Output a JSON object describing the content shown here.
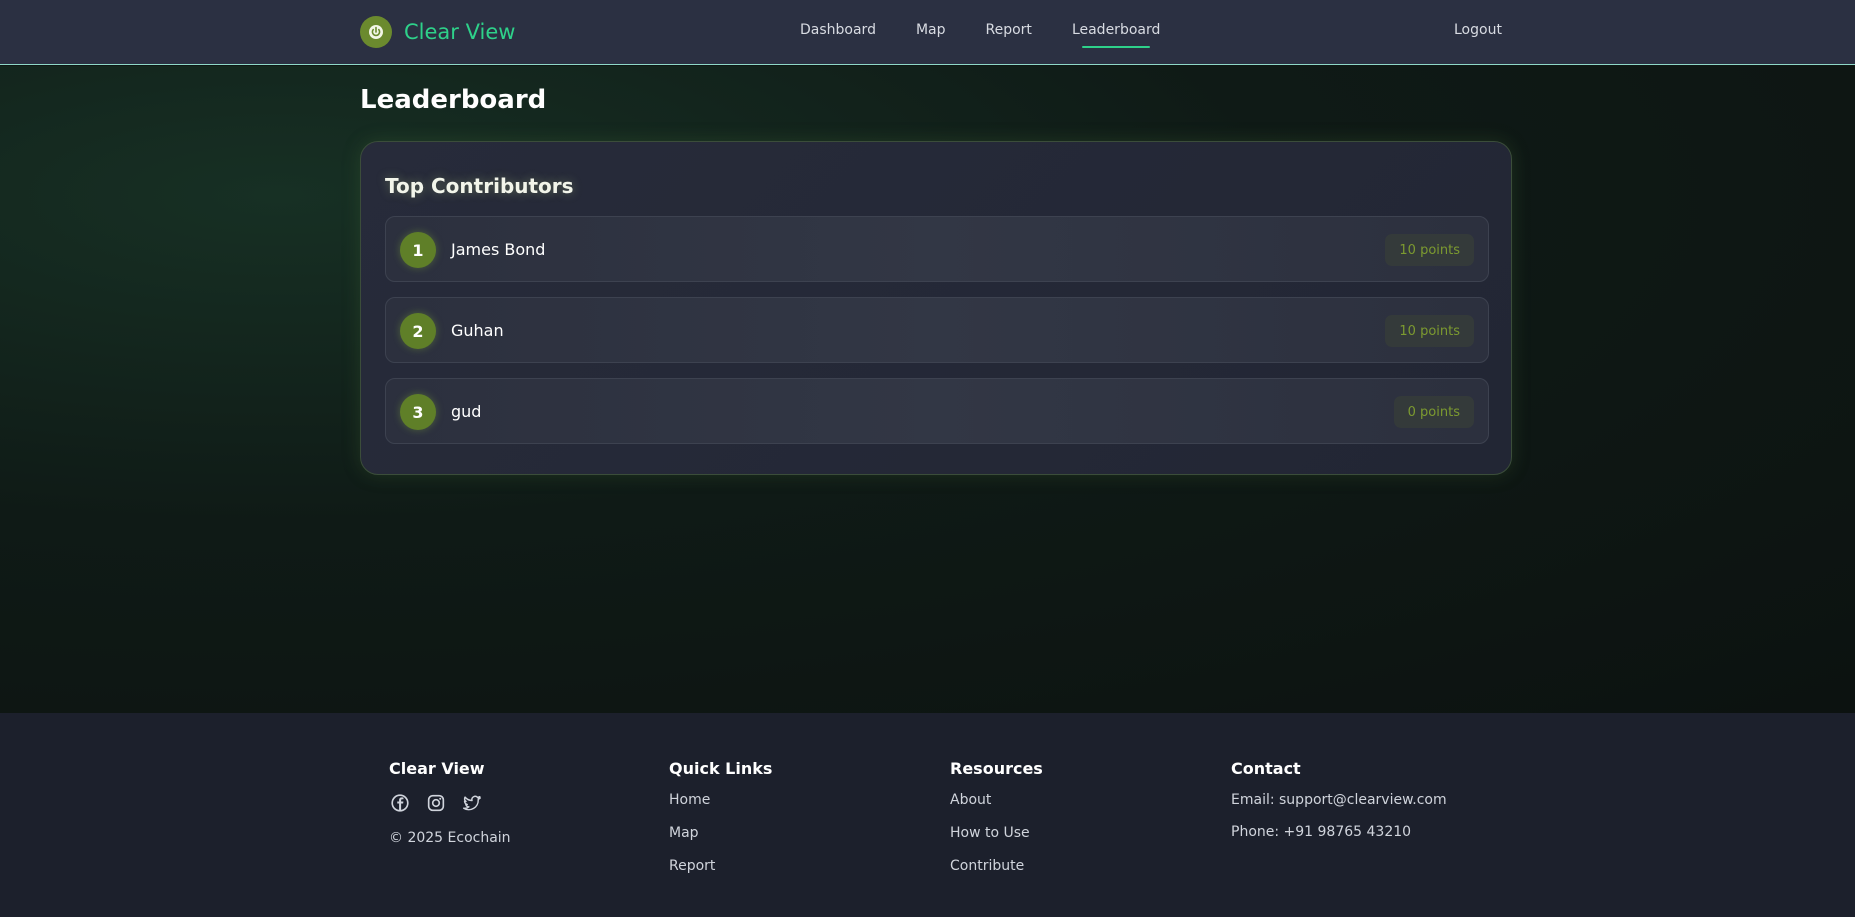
{
  "nav": {
    "brand": "Clear View",
    "links": [
      "Dashboard",
      "Map",
      "Report",
      "Leaderboard"
    ],
    "active": "Leaderboard",
    "logout": "Logout"
  },
  "page": {
    "title": "Leaderboard"
  },
  "leaderboard": {
    "heading": "Top Contributors",
    "entries": [
      {
        "rank": "1",
        "name": "James Bond",
        "points": "10 points"
      },
      {
        "rank": "2",
        "name": "Guhan",
        "points": "10 points"
      },
      {
        "rank": "3",
        "name": "gud",
        "points": "0 points"
      }
    ]
  },
  "footer": {
    "brand": {
      "title": "Clear View",
      "copyright": "© 2025 Ecochain",
      "social_icons": [
        "facebook-icon",
        "instagram-icon",
        "twitter-icon"
      ]
    },
    "quick_links": {
      "title": "Quick Links",
      "items": [
        "Home",
        "Map",
        "Report"
      ]
    },
    "resources": {
      "title": "Resources",
      "items": [
        "About",
        "How to Use",
        "Contribute"
      ]
    },
    "contact": {
      "title": "Contact",
      "email": "Email: support@clearview.com",
      "phone": "Phone: +91 98765 43210"
    }
  },
  "colors": {
    "accent": "#2ed18a",
    "rank_badge": "#5f7f28",
    "points_text": "#7c9a30",
    "navbar_bg": "#2b3042",
    "footer_bg": "#1c202c"
  }
}
